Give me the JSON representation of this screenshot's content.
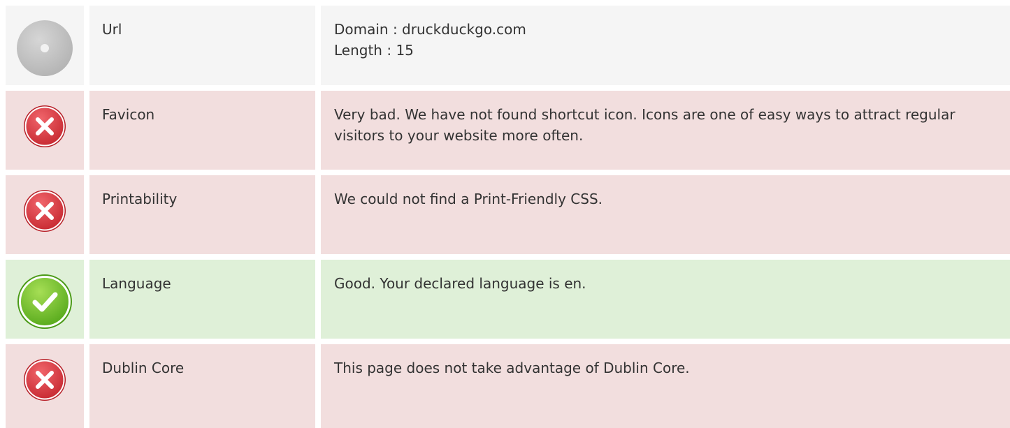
{
  "rows": [
    {
      "status": "neutral",
      "icon": "neutral-dot-icon",
      "name": "Url",
      "lines": [
        "Domain : druckduckgo.com",
        "Length : 15"
      ]
    },
    {
      "status": "bad",
      "icon": "error-x-icon",
      "name": "Favicon",
      "lines": [
        "Very bad. We have not found shortcut icon. Icons are one of easy ways to attract regular visitors to your website more often."
      ]
    },
    {
      "status": "bad",
      "icon": "error-x-icon",
      "name": "Printability",
      "lines": [
        "We could not find a Print-Friendly CSS."
      ]
    },
    {
      "status": "good",
      "icon": "checkmark-icon",
      "name": "Language",
      "lines": [
        "Good. Your declared language is en."
      ]
    },
    {
      "status": "bad",
      "icon": "error-x-icon",
      "name": "Dublin Core",
      "lines": [
        "This page does not take advantage of Dublin Core."
      ]
    }
  ],
  "colors": {
    "neutral_bg": "#f5f5f5",
    "bad_bg": "#f2dede",
    "good_bg": "#dff0d8",
    "error_red": "#d9363e",
    "success_green": "#6cbb28"
  }
}
